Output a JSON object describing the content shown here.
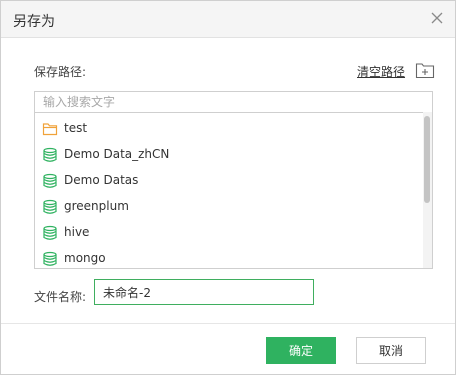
{
  "dialog": {
    "title": "另存为",
    "path_label": "保存路径:",
    "clear_path_label": "清空路径",
    "search_placeholder": "输入搜索文字",
    "file_name_label": "文件名称:",
    "file_name_value": "未命名-2",
    "ok_label": "确定",
    "cancel_label": "取消"
  },
  "tree": {
    "items": [
      {
        "label": "test",
        "icon": "folder-icon"
      },
      {
        "label": "Demo Data_zhCN",
        "icon": "database-icon"
      },
      {
        "label": "Demo Datas",
        "icon": "database-icon"
      },
      {
        "label": "greenplum",
        "icon": "database-icon"
      },
      {
        "label": "hive",
        "icon": "database-icon"
      },
      {
        "label": "mongo",
        "icon": "database-icon"
      }
    ]
  },
  "colors": {
    "accent": "#2fb260",
    "folder": "#f0a23a",
    "database": "#2fb260"
  }
}
